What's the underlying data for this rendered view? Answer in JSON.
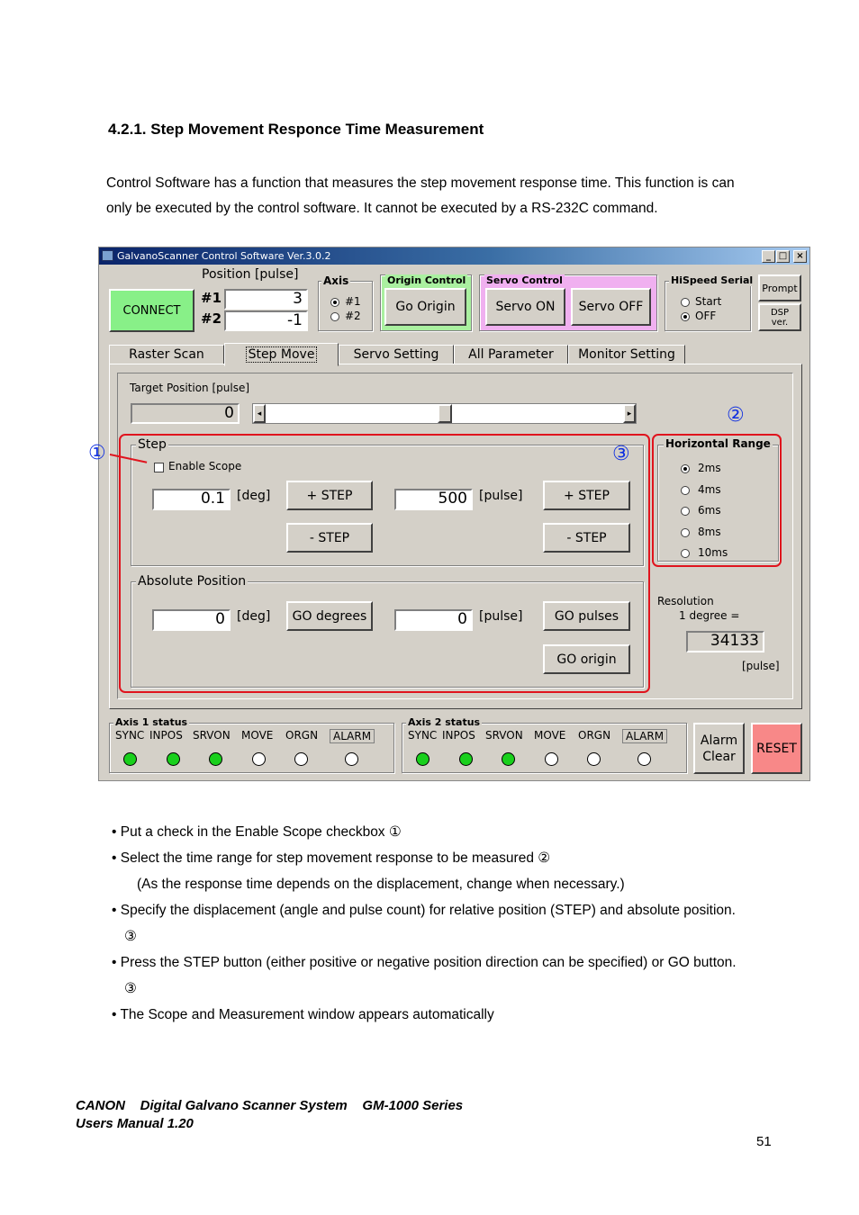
{
  "heading": "4.2.1.  Step Movement Responce Time Measurement",
  "intro": {
    "line1": "Control Software has a function that measures the step movement response time. This function is can",
    "line2": "only be executed by the control software. It cannot be executed by a RS-232C command."
  },
  "window": {
    "title": "GalvanoScanner Control Software Ver.3.0.2",
    "controls": {
      "minimize": "_",
      "maximize": "□",
      "close": "×"
    },
    "connect_label": "CONNECT",
    "position": {
      "title": "Position [pulse]",
      "row1_label": "#1",
      "row1_value": "3",
      "row2_label": "#2",
      "row2_value": "-1"
    },
    "axis": {
      "title": "Axis",
      "opt1": "#1",
      "opt2": "#2",
      "selected": "#1"
    },
    "origin_control": {
      "title": "Origin Control",
      "button": "Go Origin",
      "color": "#aaf0a0"
    },
    "servo_control": {
      "title": "Servo Control",
      "on": "Servo ON",
      "off": "Servo OFF",
      "color": "#f0b0f0"
    },
    "hispeed_serial": {
      "title": "HiSpeed Serial",
      "opt_start": "Start",
      "opt_off": "OFF",
      "selected": "OFF"
    },
    "prompt_label": "Prompt",
    "dsp_label_1": "DSP",
    "dsp_label_2": "ver.",
    "tabs": [
      "Raster Scan",
      "Step Move",
      "Servo Setting",
      "All Parameter",
      "Monitor Setting"
    ],
    "active_tab": "Step Move",
    "target": {
      "title": "Target Position [pulse]",
      "value": "0",
      "slider_value": 0.5
    },
    "step": {
      "title": "Step",
      "enable_scope": "Enable Scope",
      "enable_scope_checked": false,
      "deg_value": "0.1",
      "deg_unit": "[deg]",
      "pulse_value": "500",
      "pulse_unit": "[pulse]",
      "plus": "+ STEP",
      "minus": "- STEP"
    },
    "absolute": {
      "title": "Absolute Position",
      "deg_value": "0",
      "deg_unit": "[deg]",
      "pulse_value": "0",
      "pulse_unit": "[pulse]",
      "go_degrees": "GO degrees",
      "go_pulses": "GO pulses",
      "go_origin": "GO origin"
    },
    "horizontal_range": {
      "title": "Horizontal Range",
      "options": [
        "2ms",
        "4ms",
        "6ms",
        "8ms",
        "10ms"
      ],
      "selected": "2ms"
    },
    "resolution": {
      "line1": "Resolution",
      "line2": "1 degree =",
      "value": "34133",
      "unit": "[pulse]"
    },
    "axis1_status": {
      "title": "Axis 1 status",
      "labels": [
        "SYNC",
        "INPOS",
        "SRVON",
        "MOVE",
        "ORGN",
        "ALARM"
      ],
      "leds_on": [
        true,
        true,
        true,
        false,
        false,
        false
      ]
    },
    "axis2_status": {
      "title": "Axis 2 status",
      "labels": [
        "SYNC",
        "INPOS",
        "SRVON",
        "MOVE",
        "ORGN",
        "ALARM"
      ],
      "leds_on": [
        true,
        true,
        true,
        false,
        false,
        false
      ]
    },
    "alarm_clear_1": "Alarm",
    "alarm_clear_2": "Clear",
    "reset_label": "RESET",
    "colors": {
      "connect": "#88f088",
      "reset": "#f88888",
      "led_on": "#19d01c",
      "highlight": "#e0141e",
      "callout": "#1030e0"
    }
  },
  "callouts": {
    "c1": "①",
    "c2": "②",
    "c3": "③"
  },
  "bullets": [
    "• Put a check in the Enable Scope checkbox ①",
    "• Select the time range for step movement response to be measured ②",
    "(As the response time depends on the displacement, change when necessary.)",
    "• Specify the displacement (angle and pulse count) for relative position (STEP) and absolute position.",
    "③",
    "• Press the STEP button (either positive or negative position direction can be specified) or GO button.",
    "③",
    "• The Scope and Measurement window appears automatically"
  ],
  "footer": {
    "line1": "CANON    Digital Galvano Scanner System    GM-1000 Series",
    "line2": "Users Manual 1.20",
    "page": "51"
  }
}
